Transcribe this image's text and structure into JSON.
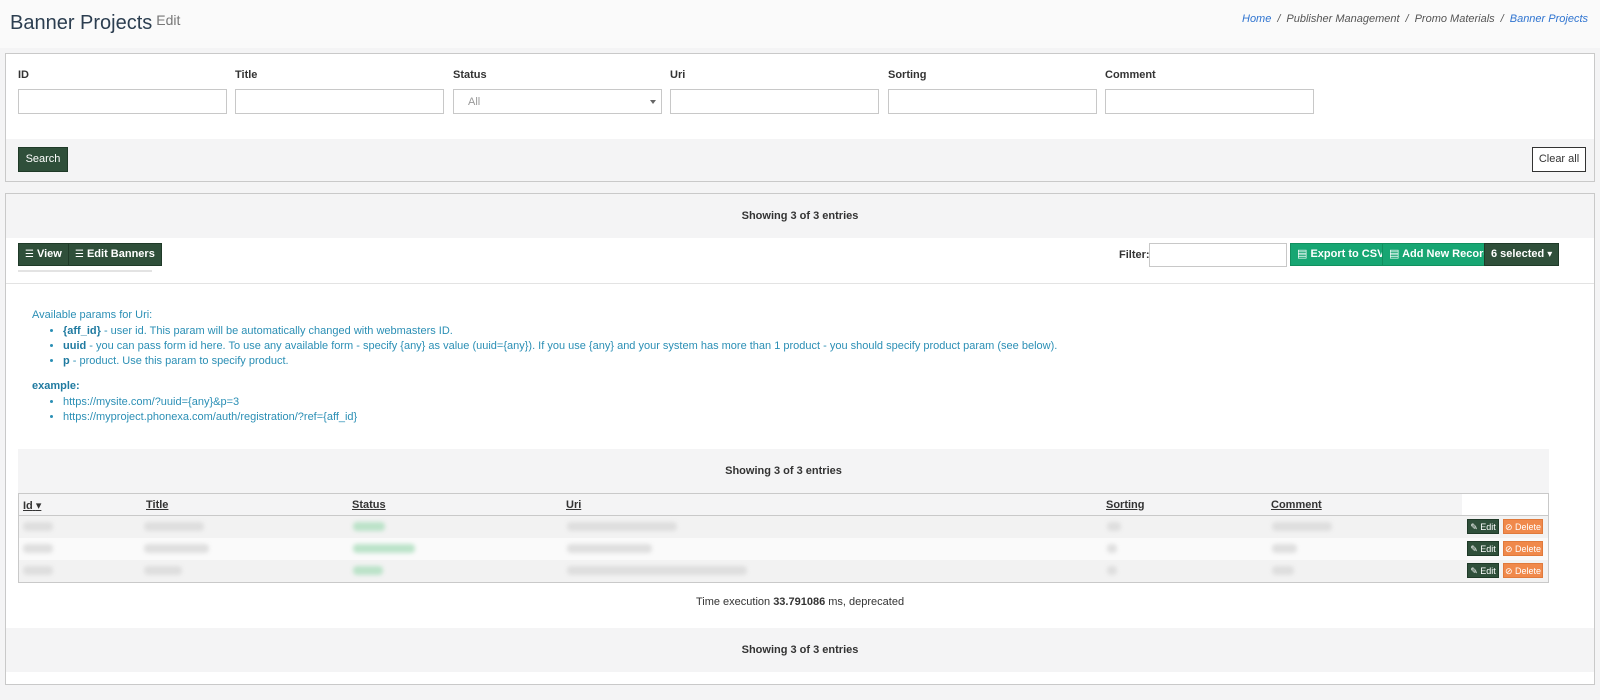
{
  "header": {
    "title": "Banner Projects",
    "subtitle": "Edit",
    "breadcrumb": {
      "home": "Home",
      "publisher_management": "Publisher Management",
      "promo_materials": "Promo Materials",
      "current": "Banner Projects",
      "separator": "/"
    }
  },
  "search": {
    "fields": {
      "id": {
        "label": "ID",
        "value": ""
      },
      "title": {
        "label": "Title",
        "value": ""
      },
      "status": {
        "label": "Status",
        "value": "All"
      },
      "uri": {
        "label": "Uri",
        "value": ""
      },
      "sorting": {
        "label": "Sorting",
        "value": ""
      },
      "comment": {
        "label": "Comment",
        "value": ""
      }
    },
    "search_label": "Search",
    "clear_label": "Clear all"
  },
  "grid": {
    "summary": "Showing 3 of 3 entries",
    "view_label": "View",
    "edit_banners_label": "Edit Banners",
    "filter_label": "Filter:",
    "export_label": "Export to CSV",
    "add_label": "Add New Record",
    "selected_label": "6 selected",
    "info": {
      "heading": "Available params for Uri:",
      "params": [
        {
          "name": "{aff_id}",
          "desc": " - user id. This param will be automatically changed with webmasters ID."
        },
        {
          "name": "uuid",
          "desc": " - you can pass form id here. To use any available form - specify {any} as value (uuid={any}). If you use {any} and your system has more than 1 product - you should specify product param (see below)."
        },
        {
          "name": "p",
          "desc": " - product. Use this param to specify product."
        }
      ],
      "example_label": "example:",
      "examples": [
        "https://mysite.com/?uuid={any}&p=3",
        "https://myproject.phonexa.com/auth/registration/?ref={aff_id}"
      ]
    },
    "columns": {
      "id": "Id",
      "title": "Title",
      "status": "Status",
      "uri": "Uri",
      "sorting": "Sorting",
      "comment": "Comment"
    },
    "row_actions": {
      "edit": "Edit",
      "delete": "Delete"
    },
    "timing": {
      "prefix": "Time execution ",
      "value": "33.791086",
      "suffix": " ms, deprecated"
    }
  },
  "colors": {
    "primary_dark": "#2f4f3a",
    "success": "#17a673",
    "warning": "#f0894b",
    "link": "#2f74d0",
    "info_text": "#2b8fb5"
  },
  "icons": {
    "view": "list-icon",
    "edit_banners": "list-icon",
    "export": "file-icon",
    "add": "file-icon",
    "edit": "pencil-icon",
    "delete": "ban-icon"
  }
}
